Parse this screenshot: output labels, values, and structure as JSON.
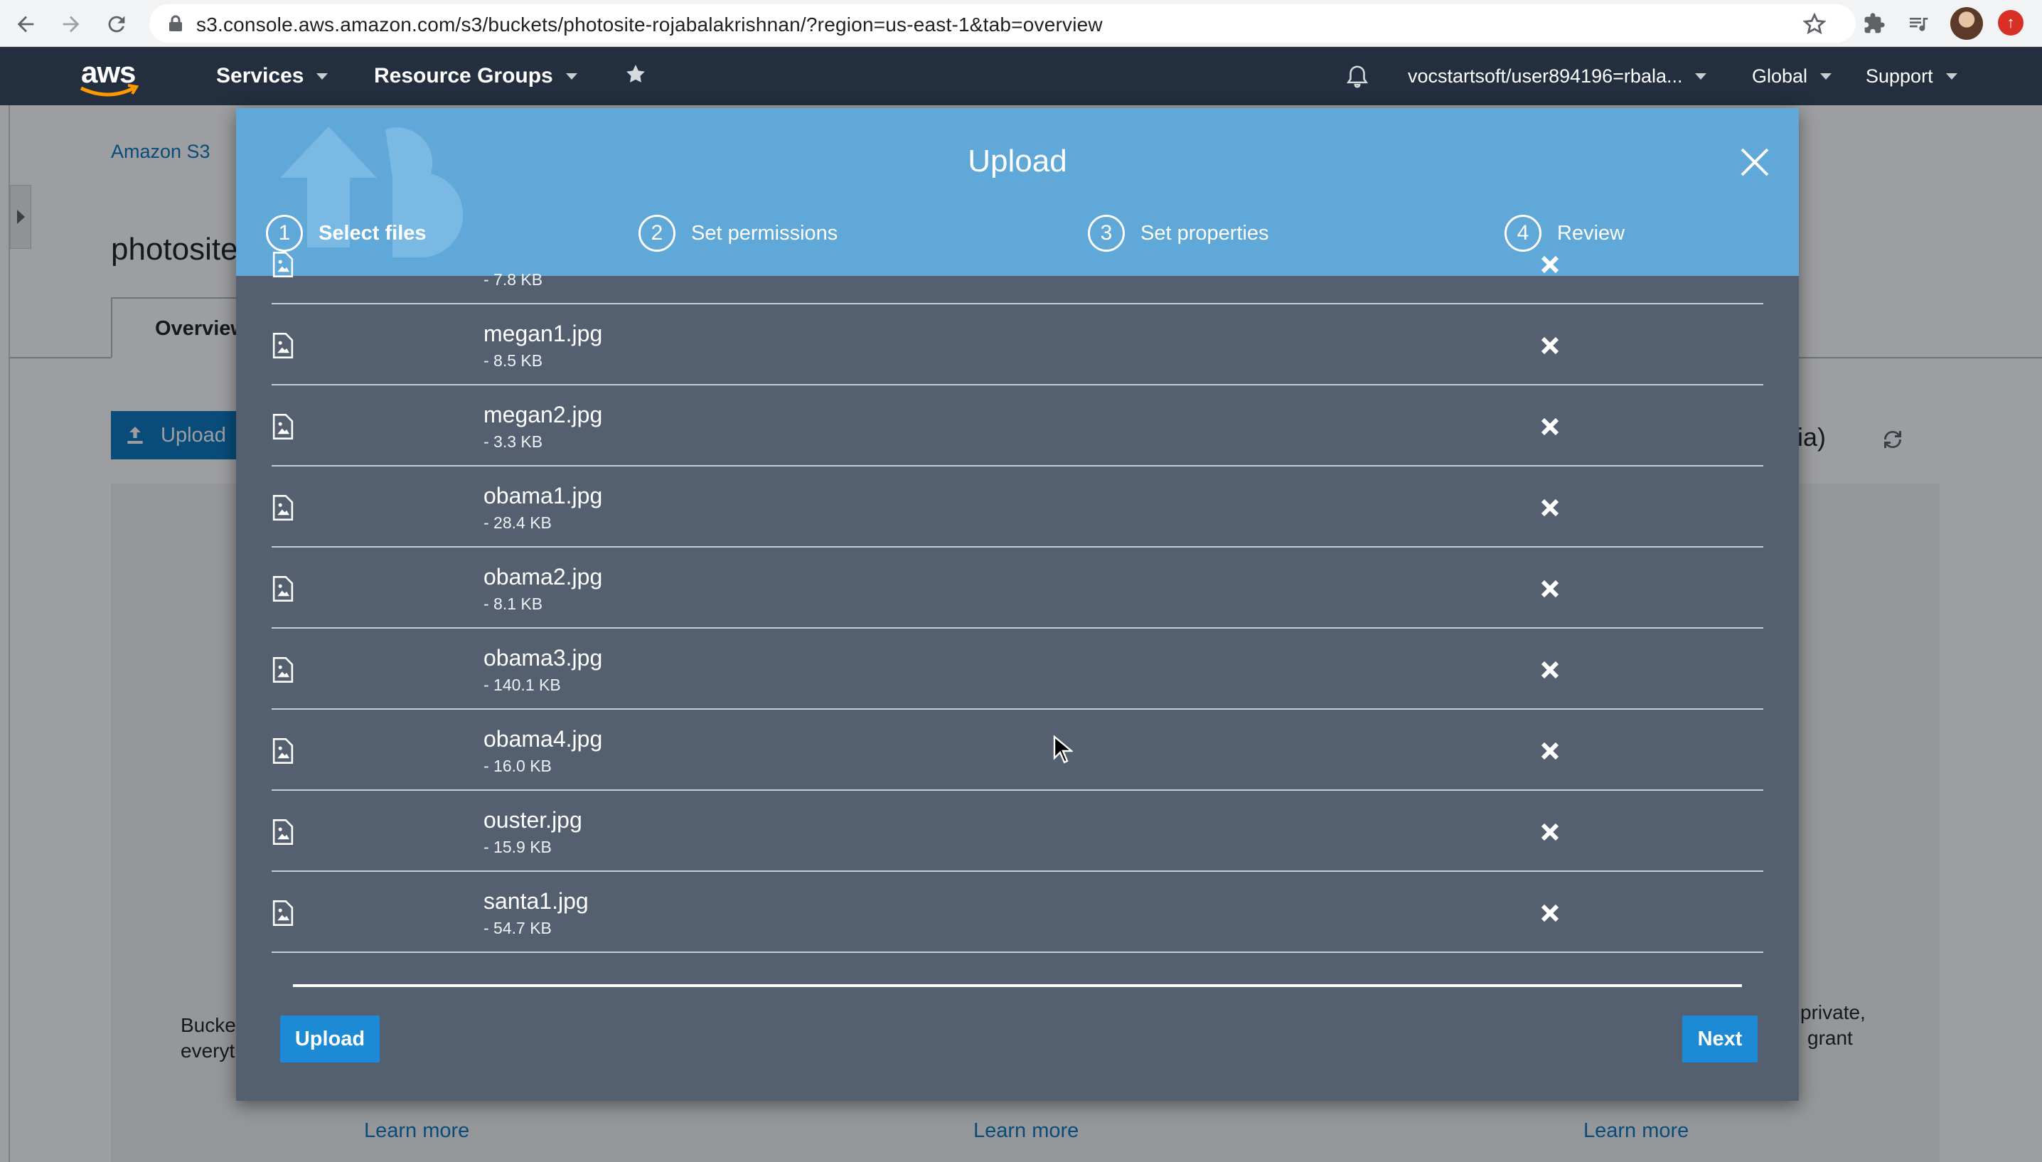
{
  "browser": {
    "url": "s3.console.aws.amazon.com/s3/buckets/photosite-rojabalakrishnan/?region=us-east-1&tab=overview"
  },
  "aws_nav": {
    "logo_text": "aws",
    "services": "Services",
    "resource_groups": "Resource Groups",
    "account": "vocstartsoft/user894196=rbala...",
    "region": "Global",
    "support": "Support"
  },
  "background": {
    "breadcrumb": "Amazon S3",
    "bucket_title": "photosite",
    "tab_overview": "Overview",
    "upload_button": "Upload",
    "region_fragment": "inia)",
    "left_text_line1": "Bucke",
    "left_text_line2": "everyt",
    "right_text_line1": "private,",
    "right_text_line2": "grant",
    "learn_more": [
      "Learn more",
      "Learn more",
      "Learn more"
    ]
  },
  "modal": {
    "title": "Upload",
    "steps": [
      {
        "num": "1",
        "label": "Select files"
      },
      {
        "num": "2",
        "label": "Set permissions"
      },
      {
        "num": "3",
        "label": "Set properties"
      },
      {
        "num": "4",
        "label": "Review"
      }
    ],
    "files": [
      {
        "name": "",
        "size": "- 7.8 KB"
      },
      {
        "name": "megan1.jpg",
        "size": "- 8.5 KB"
      },
      {
        "name": "megan2.jpg",
        "size": "- 3.3 KB"
      },
      {
        "name": "obama1.jpg",
        "size": "- 28.4 KB"
      },
      {
        "name": "obama2.jpg",
        "size": "- 8.1 KB"
      },
      {
        "name": "obama3.jpg",
        "size": "- 140.1 KB"
      },
      {
        "name": "obama4.jpg",
        "size": "- 16.0 KB"
      },
      {
        "name": "ouster.jpg",
        "size": "- 15.9 KB"
      },
      {
        "name": "santa1.jpg",
        "size": "- 54.7 KB"
      }
    ],
    "upload_button": "Upload",
    "next_button": "Next"
  },
  "colors": {
    "aws_nav_bg": "#232f3e",
    "modal_header": "#5fa8d8",
    "modal_body": "#546070",
    "primary_button": "#1c8ad4",
    "link": "#0073bb"
  },
  "icons": [
    "back-icon",
    "forward-icon",
    "reload-icon",
    "lock-icon",
    "star-icon",
    "puzzle-icon",
    "media-icon",
    "bell-icon",
    "pin-icon",
    "close-icon",
    "image-file-icon",
    "remove-icon",
    "refresh-icon",
    "cursor-icon"
  ]
}
